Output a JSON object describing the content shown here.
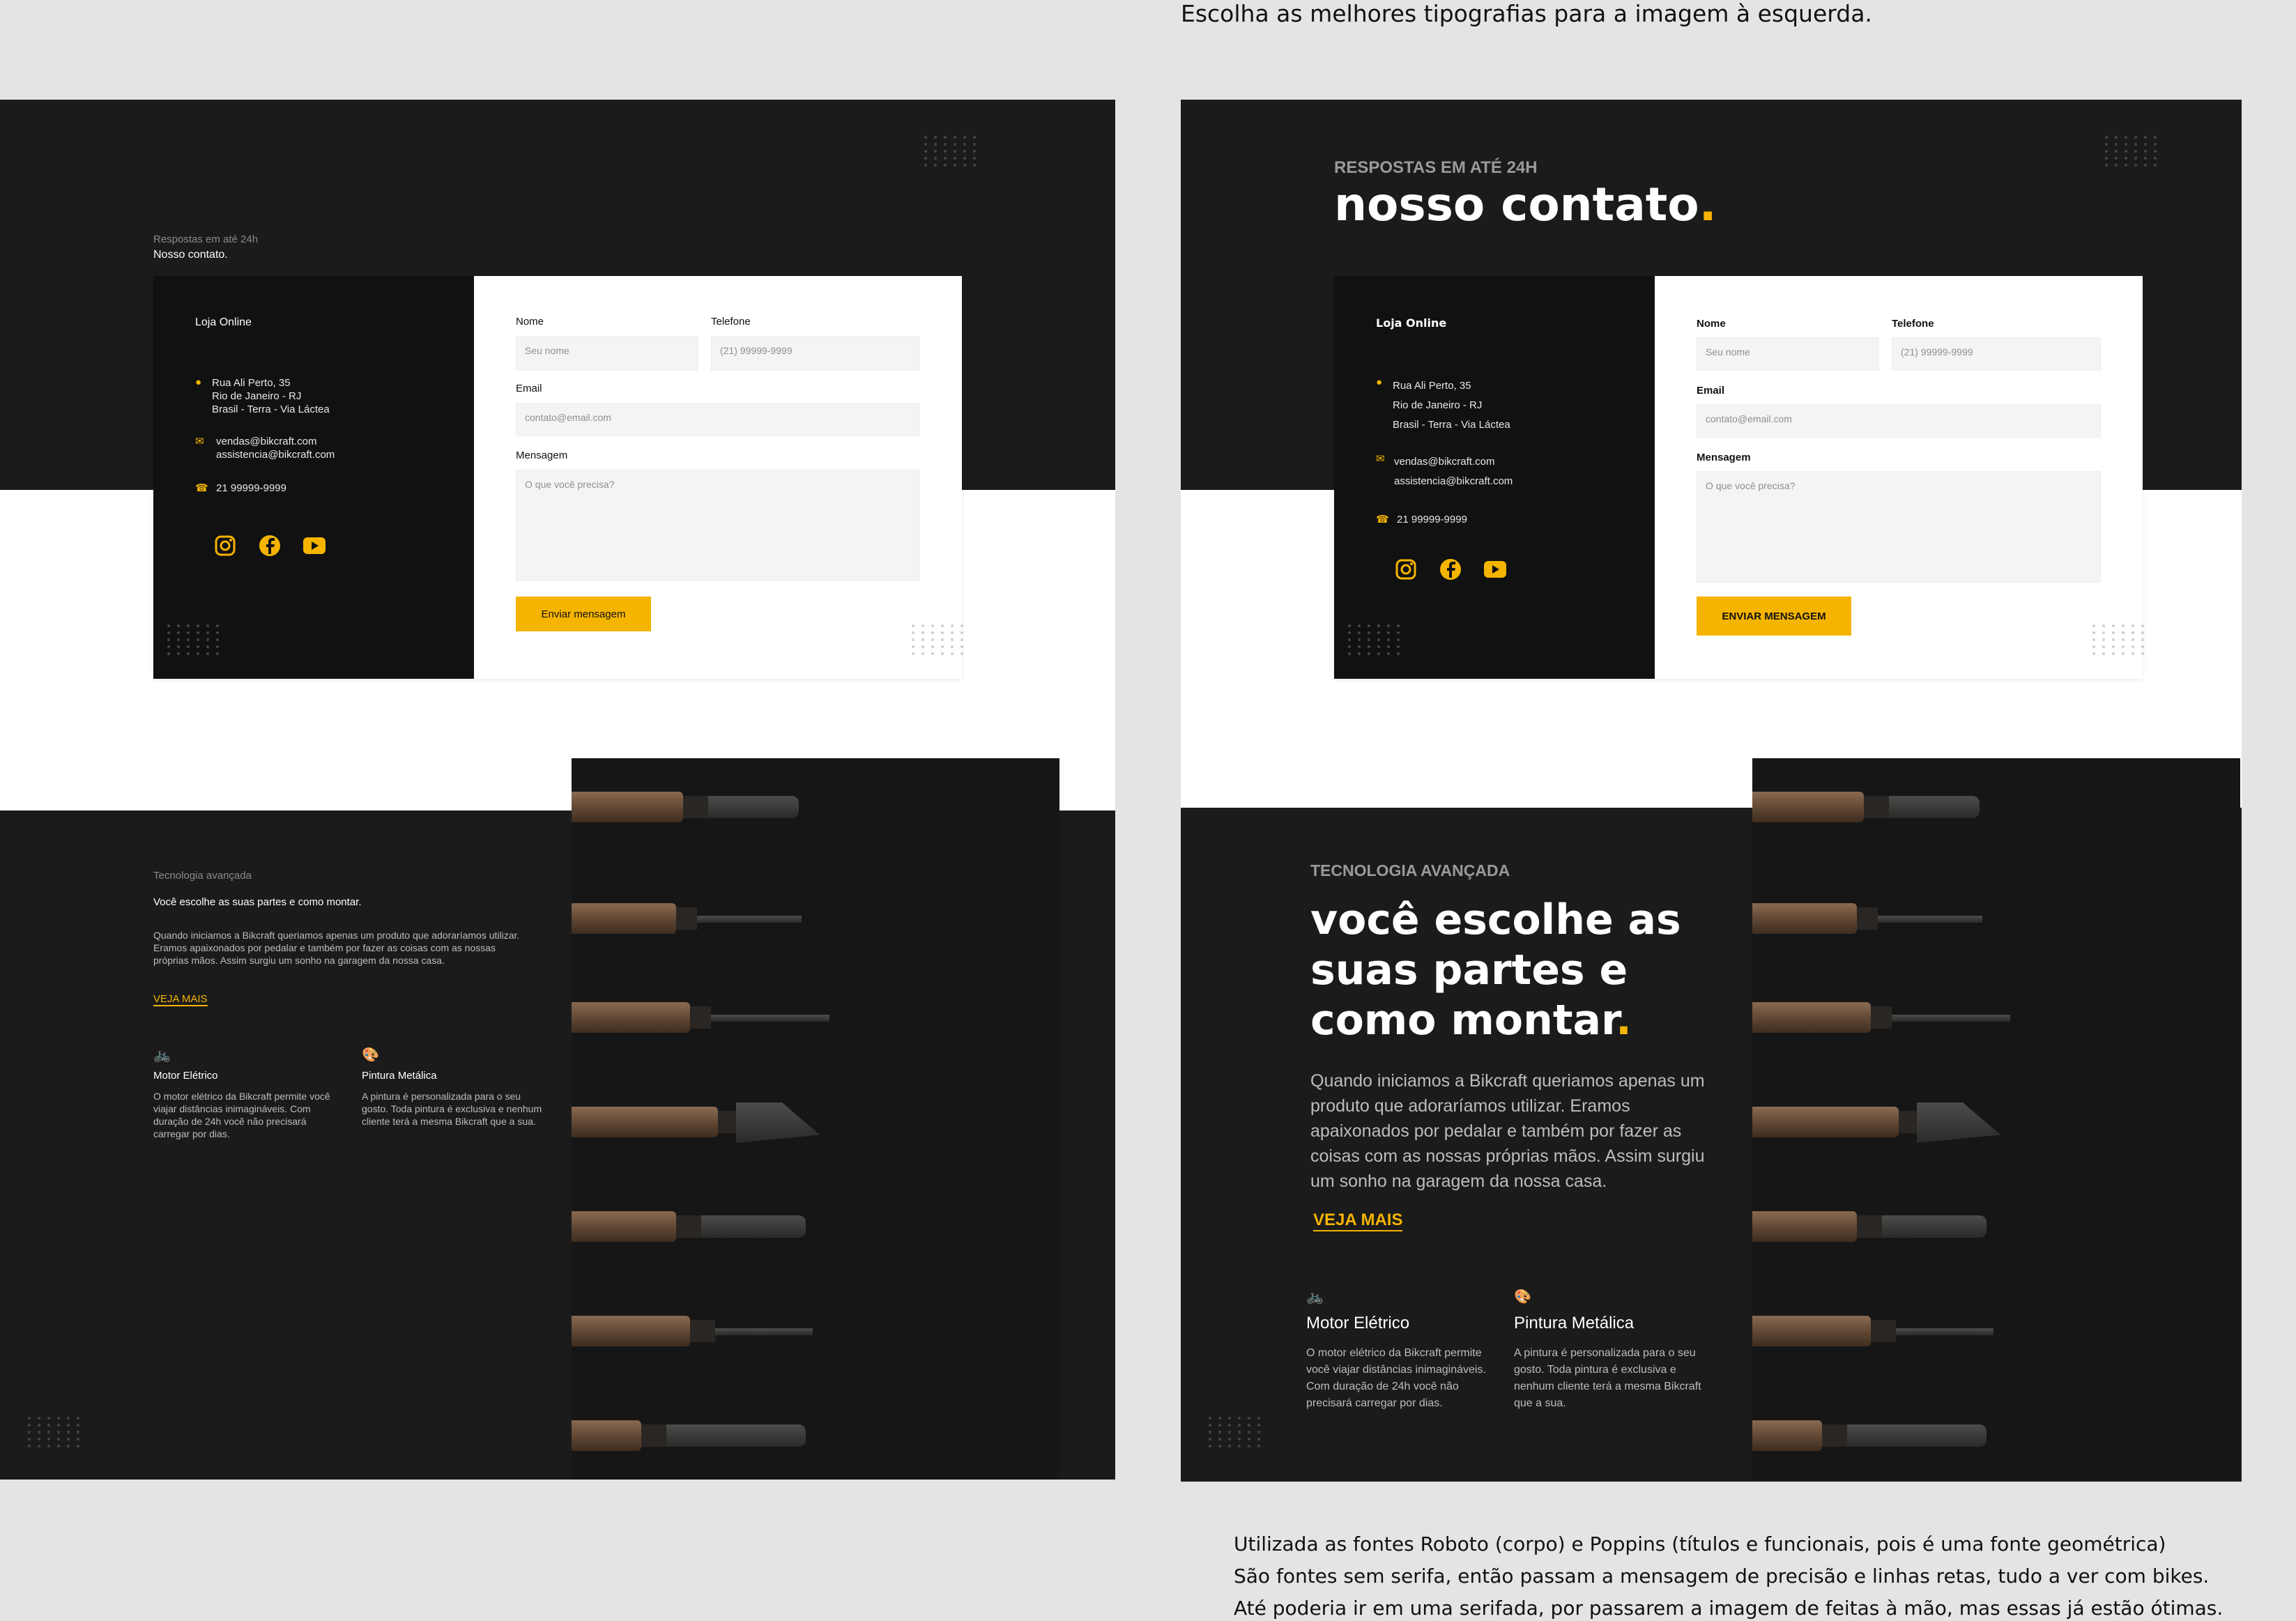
{
  "instruction": "Escolha as melhores tipografias para a imagem à esquerda.",
  "accent": "#f5b400",
  "left": {
    "kicker": "Respostas em até 24h",
    "title": "Nosso contato.",
    "store": "Loja Online",
    "address": [
      "Rua Ali Perto, 35",
      "Rio de Janeiro - RJ",
      "Brasil - Terra - Via Láctea"
    ],
    "emails": [
      "vendas@bikcraft.com",
      "assistencia@bikcraft.com"
    ],
    "phone": "21 99999-9999",
    "form": {
      "name_label": "Nome",
      "name_placeholder": "Seu nome",
      "phone_label": "Telefone",
      "phone_placeholder": "(21) 99999-9999",
      "email_label": "Email",
      "email_placeholder": "contato@email.com",
      "message_label": "Mensagem",
      "message_placeholder": "O que você precisa?",
      "submit": "Enviar mensagem"
    },
    "tech_kicker": "Tecnologia avançada",
    "tech_title": "Você escolhe as suas partes e como montar.",
    "tech_body": "Quando iniciamos a Bikcraft queriamos apenas um produto que adoraríamos utilizar. Eramos apaixonados por pedalar e também por fazer as coisas com as nossas próprias mãos. Assim surgiu um sonho na garagem da nossa casa.",
    "more": "VEJA MAIS",
    "features": [
      {
        "title": "Motor Elétrico",
        "text": "O motor elétrico da Bikcraft permite você viajar distâncias inimagináveis. Com duração de 24h você não precisará carregar por dias."
      },
      {
        "title": "Pintura Metálica",
        "text": "A pintura é personalizada para o seu gosto. Toda pintura é exclusiva e nenhum cliente terá a mesma Bikcraft que a sua."
      }
    ]
  },
  "right": {
    "kicker": "RESPOSTAS EM ATÉ 24H",
    "title": "nosso contato",
    "title_dot": ".",
    "store": "Loja Online",
    "address": [
      "Rua Ali Perto, 35",
      "Rio de Janeiro - RJ",
      "Brasil - Terra - Via Láctea"
    ],
    "emails": [
      "vendas@bikcraft.com",
      "assistencia@bikcraft.com"
    ],
    "phone": "21 99999-9999",
    "form": {
      "name_label": "Nome",
      "name_placeholder": "Seu nome",
      "phone_label": "Telefone",
      "phone_placeholder": "(21) 99999-9999",
      "email_label": "Email",
      "email_placeholder": "contato@email.com",
      "message_label": "Mensagem",
      "message_placeholder": "O que você precisa?",
      "submit": "ENVIAR MENSAGEM"
    },
    "tech_kicker": "TECNOLOGIA AVANÇADA",
    "tech_title": "você escolhe as suas partes e como montar",
    "tech_title_dot": ".",
    "tech_body": "Quando iniciamos a Bikcraft queriamos apenas um produto que adoraríamos utilizar. Eramos apaixonados por pedalar e também por fazer as coisas com as nossas próprias mãos. Assim surgiu um sonho na garagem da nossa casa.",
    "more": "VEJA MAIS",
    "features": [
      {
        "title": "Motor Elétrico",
        "text": "O motor elétrico da Bikcraft permite você viajar distâncias inimagináveis. Com duração de 24h você não precisará carregar por dias."
      },
      {
        "title": "Pintura Metálica",
        "text": "A pintura é personalizada para o seu gosto. Toda pintura é exclusiva e nenhum cliente terá a mesma Bikcraft que a sua."
      }
    ]
  },
  "footer": [
    "Utilizada as fontes Roboto (corpo) e Poppins (títulos e  funcionais, pois é uma fonte geométrica)",
    "São fontes sem serifa, então passam a mensagem de precisão e linhas retas, tudo a ver com bikes.",
    "Até poderia ir em uma serifada, por passarem a imagem de feitas à mão, mas essas já estão ótimas."
  ],
  "icons": [
    "location-pin-icon",
    "email-icon",
    "phone-icon",
    "instagram-icon",
    "facebook-icon",
    "youtube-icon",
    "bike-icon",
    "palette-icon"
  ]
}
